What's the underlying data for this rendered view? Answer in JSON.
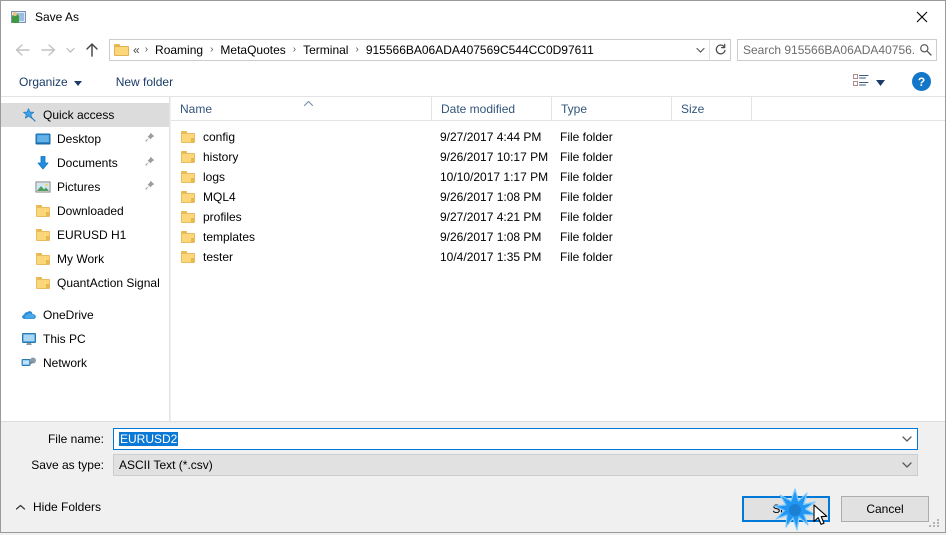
{
  "window": {
    "title": "Save As",
    "title_icon": "save-as-app-icon",
    "close_icon": "close-icon"
  },
  "nav": {
    "back_icon": "back-arrow-icon",
    "forward_icon": "forward-arrow-icon",
    "recent_icon": "chevron-down-icon",
    "up_icon": "up-arrow-icon",
    "folder_icon": "folder-icon",
    "breadcrumb_prefix": "«",
    "breadcrumb": [
      "Roaming",
      "MetaQuotes",
      "Terminal",
      "915566BA06ADA407569C544CC0D97611"
    ],
    "address_caret_icon": "chevron-down-icon",
    "refresh_icon": "refresh-icon",
    "separator": "›"
  },
  "search": {
    "placeholder": "Search 915566BA06ADA40756...",
    "value": "",
    "icon": "search-icon"
  },
  "toolbar": {
    "organize_label": "Organize",
    "organize_caret_icon": "caret-down-icon",
    "new_folder_label": "New folder",
    "view_icon": "view-mode-icon",
    "view_caret_icon": "caret-down-icon",
    "help_label": "?",
    "help_icon": "help-icon"
  },
  "sidebar": {
    "items": [
      {
        "label": "Quick access",
        "icon": "star-pin-icon",
        "selected": true,
        "indent": false,
        "pinned": false
      },
      {
        "label": "Desktop",
        "icon": "desktop-icon",
        "selected": false,
        "indent": true,
        "pinned": true
      },
      {
        "label": "Documents",
        "icon": "documents-icon",
        "selected": false,
        "indent": true,
        "pinned": true
      },
      {
        "label": "Pictures",
        "icon": "pictures-icon",
        "selected": false,
        "indent": true,
        "pinned": true
      },
      {
        "label": "Downloaded",
        "icon": "folder-icon",
        "selected": false,
        "indent": true,
        "pinned": false
      },
      {
        "label": "EURUSD H1",
        "icon": "folder-icon",
        "selected": false,
        "indent": true,
        "pinned": false
      },
      {
        "label": "My Work",
        "icon": "folder-icon",
        "selected": false,
        "indent": true,
        "pinned": false
      },
      {
        "label": "QuantAction Signal",
        "icon": "folder-icon",
        "selected": false,
        "indent": true,
        "pinned": false
      },
      {
        "label": "OneDrive",
        "icon": "onedrive-icon",
        "selected": false,
        "indent": false,
        "pinned": false
      },
      {
        "label": "This PC",
        "icon": "this-pc-icon",
        "selected": false,
        "indent": false,
        "pinned": false
      },
      {
        "label": "Network",
        "icon": "network-icon",
        "selected": false,
        "indent": false,
        "pinned": false
      }
    ]
  },
  "filelist": {
    "columns": [
      "Name",
      "Date modified",
      "Type",
      "Size"
    ],
    "sort_column": "Name",
    "sort_direction": "ascending",
    "rows": [
      {
        "name": "config",
        "date": "9/27/2017 4:44 PM",
        "type": "File folder",
        "size": "",
        "icon": "folder-icon"
      },
      {
        "name": "history",
        "date": "9/26/2017 10:17 PM",
        "type": "File folder",
        "size": "",
        "icon": "folder-icon"
      },
      {
        "name": "logs",
        "date": "10/10/2017 1:17 PM",
        "type": "File folder",
        "size": "",
        "icon": "folder-icon"
      },
      {
        "name": "MQL4",
        "date": "9/26/2017 1:08 PM",
        "type": "File folder",
        "size": "",
        "icon": "folder-icon"
      },
      {
        "name": "profiles",
        "date": "9/27/2017 4:21 PM",
        "type": "File folder",
        "size": "",
        "icon": "folder-icon"
      },
      {
        "name": "templates",
        "date": "9/26/2017 1:08 PM",
        "type": "File folder",
        "size": "",
        "icon": "folder-icon"
      },
      {
        "name": "tester",
        "date": "10/4/2017 1:35 PM",
        "type": "File folder",
        "size": "",
        "icon": "folder-icon"
      }
    ]
  },
  "form": {
    "filename_label": "File name:",
    "filename_value": "EURUSD2",
    "filename_selected": true,
    "filetype_label": "Save as type:",
    "filetype_value": "ASCII Text (*.csv)",
    "caret_icon": "chevron-down-icon"
  },
  "footer": {
    "hide_folders_label": "Hide Folders",
    "hide_folders_icon": "chevron-up-icon",
    "save_label": "Save",
    "cancel_label": "Cancel",
    "resize_grip_icon": "resize-grip-icon",
    "click_burst_icon": "click-burst-icon",
    "cursor_icon": "mouse-cursor-icon"
  },
  "colors": {
    "accent": "#0078d7",
    "selection": "#0a78d4",
    "header_text": "#33557a",
    "toolbar_text": "#1b3c67",
    "folder": "#fcd77a",
    "help_blue": "#1276c9"
  }
}
